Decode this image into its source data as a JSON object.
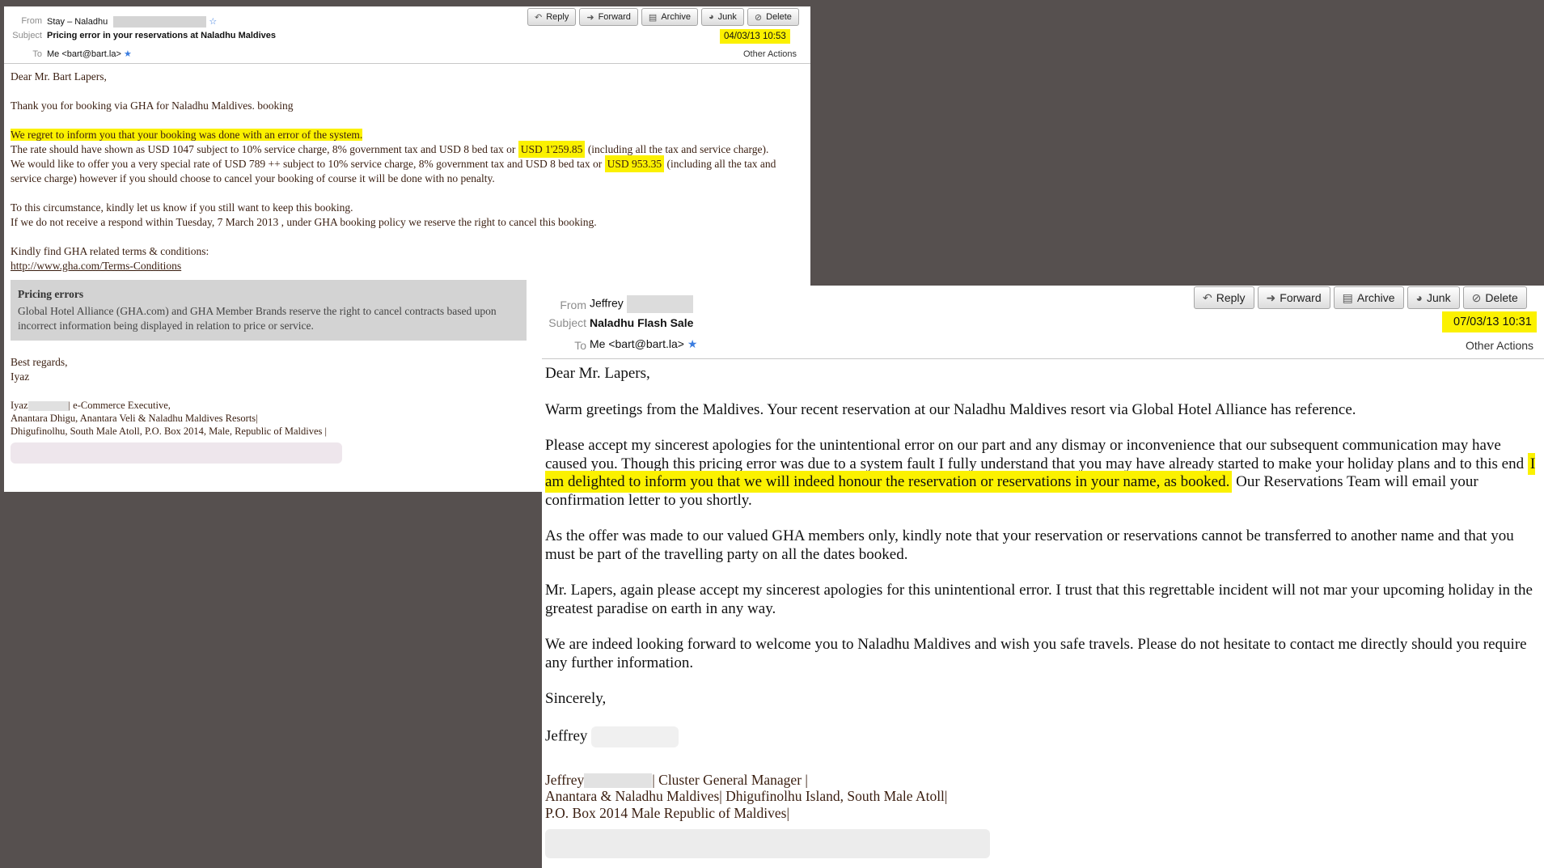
{
  "email1": {
    "header": {
      "from_label": "From",
      "from_value": "Stay – Naladhu",
      "subject_label": "Subject",
      "subject_value": "Pricing error in your reservations at Naladhu Maldives",
      "to_label": "To",
      "to_value": "Me <bart@bart.la>",
      "date": "04/03/13 10:53",
      "other_actions": "Other Actions"
    },
    "toolbar": {
      "reply": "Reply",
      "forward": "Forward",
      "archive": "Archive",
      "junk": "Junk",
      "delete": "Delete"
    },
    "body": {
      "greeting": "Dear Mr. Bart Lapers,",
      "thanks": "Thank you for booking via GHA for Naladhu Maldives. booking",
      "regret": "We regret to inform you that your booking was done with an error of the system.",
      "rate_a": "The rate should have shown as USD 1047 subject to 10% service charge, 8% government tax and USD 8 bed tax or",
      "rate_amount": "USD 1'259.85",
      "rate_b": "(including  all the tax and service charge).",
      "offer_a": "We would like to offer you a very special rate of USD 789 ++ subject to 10% service charge, 8% government tax and USD 8 bed tax or",
      "offer_amount": "USD 953.35",
      "offer_b": "(including  all the tax and service charge) however if you should choose to cancel your booking of course it will be done with no penalty.",
      "circumstance": "To this circumstance, kindly let us know if you still want to keep this booking.",
      "deadline": "If we do not receive a respond within Tuesday, 7 March 2013 , under GHA booking policy we reserve the right to cancel this booking.",
      "terms_intro": "Kindly find GHA related terms & conditions:",
      "terms_link": "http://www.gha.com/Terms-Conditions",
      "box_title": "Pricing errors",
      "box_text": "Global Hotel Alliance (GHA.com) and GHA Member Brands reserve the right to cancel contracts based upon incorrect information being displayed in relation to price or service.",
      "closing": "Best regards,",
      "name": "Iyaz",
      "sig_name": "Iyaz",
      "sig_title": "| e-Commerce Executive,",
      "sig_line2": "Anantara Dhigu, Anantara Veli & Naladhu Maldives Resorts|",
      "sig_line3": "Dhigufinolhu, South Male Atoll, P.O. Box 2014, Male, Republic of Maldives |"
    }
  },
  "email2": {
    "header": {
      "from_label": "From",
      "from_value": "Jeffrey",
      "subject_label": "Subject",
      "subject_value": "Naladhu Flash Sale",
      "to_label": "To",
      "to_value": "Me <bart@bart.la>",
      "date": "07/03/13 10:31",
      "other_actions": "Other Actions"
    },
    "toolbar": {
      "reply": "Reply",
      "forward": "Forward",
      "archive": "Archive",
      "junk": "Junk",
      "delete": "Delete"
    },
    "body": {
      "greeting": "Dear Mr. Lapers,",
      "warm": "Warm greetings from the Maldives.  Your recent reservation at our Naladhu Maldives resort via Global Hotel Alliance has reference.",
      "apology_a": "Please accept my sincerest apologies for the unintentional error on our part and any dismay or inconvenience that our subsequent communication may have caused you.  Though this pricing error was due to a system fault I fully understand that you may have already started to make your holiday plans and to this end",
      "apology_hl": "I am delighted to inform you that we will indeed honour the reservation or reservations in your name, as booked.",
      "apology_b": "Our Reservations Team will email your confirmation letter to you shortly.",
      "offer": "As the offer was made to our valued GHA members only, kindly note that your reservation or reservations cannot be transferred to another name and that you must be part of the travelling party on all the dates booked.",
      "again": "Mr. Lapers, again please accept my sincerest apologies for this unintentional error.  I trust that this regrettable incident will not mar your upcoming holiday in the greatest paradise on earth in any way.",
      "forward": "We are indeed looking forward to welcome you to Naladhu Maldives and wish you safe travels.  Please do not hesitate to contact me directly should you require any further information.",
      "closing": "Sincerely,",
      "name": "Jeffrey",
      "sig_name": "Jeffrey",
      "sig_title": "| Cluster General Manager |",
      "sig_line2": "Anantara & Naladhu Maldives| Dhigufinolhu Island, South Male Atoll|",
      "sig_line3": "P.O. Box 2014 Male Republic of Maldives|"
    }
  },
  "icons": {
    "reply": "reply-icon",
    "forward": "forward-icon",
    "archive": "archive-icon",
    "junk": "junk-icon",
    "delete": "delete-icon",
    "star": "star-icon"
  },
  "colors": {
    "background": "#56504f",
    "highlight": "#fbf100",
    "pricing_box": "#d3d3d3",
    "email1_text": "#3a1e10"
  }
}
